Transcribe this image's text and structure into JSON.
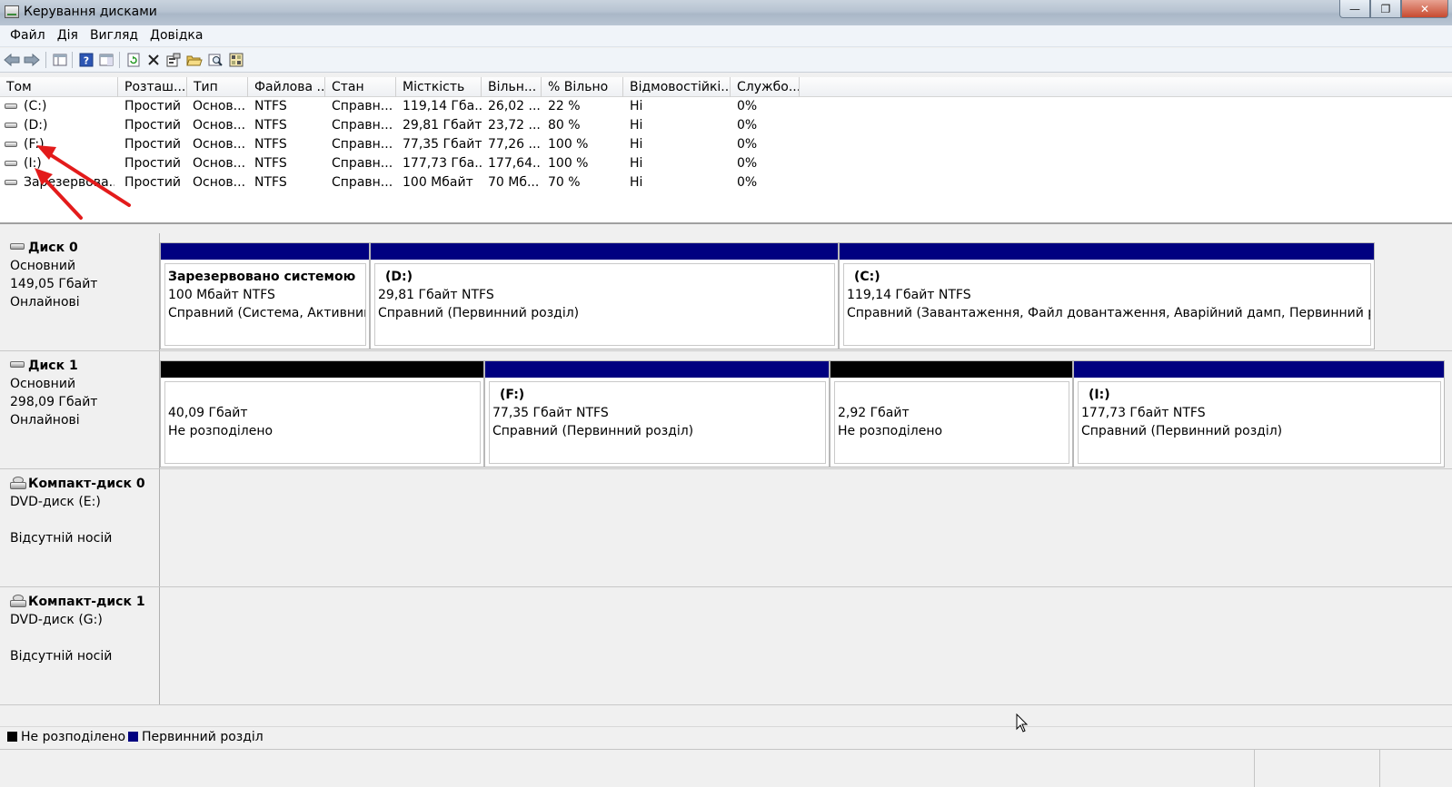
{
  "window": {
    "title": "Керування дисками"
  },
  "menu": [
    "Файл",
    "Дія",
    "Вигляд",
    "Довідка"
  ],
  "toolbar_icons": [
    "back-arrow-icon",
    "forward-arrow-icon",
    "console-tree-icon",
    "help-icon",
    "properties-pane-icon",
    "refresh-icon",
    "delete-icon",
    "properties-icon",
    "open-folder-icon",
    "rescan-disks-icon",
    "wizard-icon"
  ],
  "volume_table": {
    "columns": [
      "Том",
      "Розташ...",
      "Тип",
      "Файлова ...",
      "Стан",
      "Місткість",
      "Вільн...",
      "% Вільно",
      "Відмовостійкі...",
      "Службо..."
    ],
    "rows": [
      [
        "(C:)",
        "Простий",
        "Основ...",
        "NTFS",
        "Справн...",
        "119,14 Гба...",
        "26,02 ...",
        "22 %",
        "Ні",
        "0%"
      ],
      [
        "(D:)",
        "Простий",
        "Основ...",
        "NTFS",
        "Справн...",
        "29,81 Гбайт",
        "23,72 ...",
        "80 %",
        "Ні",
        "0%"
      ],
      [
        "(F:)",
        "Простий",
        "Основ...",
        "NTFS",
        "Справн...",
        "77,35 Гбайт",
        "77,26 ...",
        "100 %",
        "Ні",
        "0%"
      ],
      [
        "(I:)",
        "Простий",
        "Основ...",
        "NTFS",
        "Справн...",
        "177,73 Гба...",
        "177,64...",
        "100 %",
        "Ні",
        "0%"
      ],
      [
        "Зарезервова...",
        "Простий",
        "Основ...",
        "NTFS",
        "Справн...",
        "100 Мбайт",
        "70 Мб...",
        "70 %",
        "Ні",
        "0%"
      ]
    ]
  },
  "disks": [
    {
      "name": "Диск 0",
      "kind": "Основний",
      "size": "149,05 Гбайт",
      "state": "Онлайнові",
      "partitions": [
        {
          "type": "primary",
          "name": "Зарезервовано системою",
          "size": "100 Мбайт NTFS",
          "status": "Справний (Система, Активний, Первинний розділ)"
        },
        {
          "type": "primary",
          "name": "(D:)",
          "size": "29,81 Гбайт NTFS",
          "status": "Справний (Первинний розділ)"
        },
        {
          "type": "primary",
          "name": "(C:)",
          "size": "119,14 Гбайт NTFS",
          "status": "Справний (Завантаження, Файл довантаження, Аварійний дамп, Первинний розділ)"
        }
      ]
    },
    {
      "name": "Диск 1",
      "kind": "Основний",
      "size": "298,09 Гбайт",
      "state": "Онлайнові",
      "partitions": [
        {
          "type": "unallocated",
          "name": "",
          "size": "40,09 Гбайт",
          "status": "Не розподілено"
        },
        {
          "type": "primary",
          "name": "(F:)",
          "size": "77,35 Гбайт NTFS",
          "status": "Справний (Первинний розділ)"
        },
        {
          "type": "unallocated",
          "name": "",
          "size": "2,92 Гбайт",
          "status": "Не розподілено"
        },
        {
          "type": "primary",
          "name": "(I:)",
          "size": "177,73 Гбайт NTFS",
          "status": "Справний (Первинний розділ)"
        }
      ]
    },
    {
      "name": "Компакт-диск 0",
      "kind": "DVD-диск (E:)",
      "size": "",
      "state": "Відсутній носій"
    },
    {
      "name": "Компакт-диск 1",
      "kind": "DVD-диск (G:)",
      "size": "",
      "state": "Відсутній носій"
    }
  ],
  "legend": [
    {
      "label": "Не розподілено",
      "color": "#000000"
    },
    {
      "label": "Первинний розділ",
      "color": "#000080"
    }
  ],
  "colors": {
    "primary_bar": "#000080",
    "unallocated_bar": "#000000",
    "annotation_arrow": "#e31b1b"
  }
}
